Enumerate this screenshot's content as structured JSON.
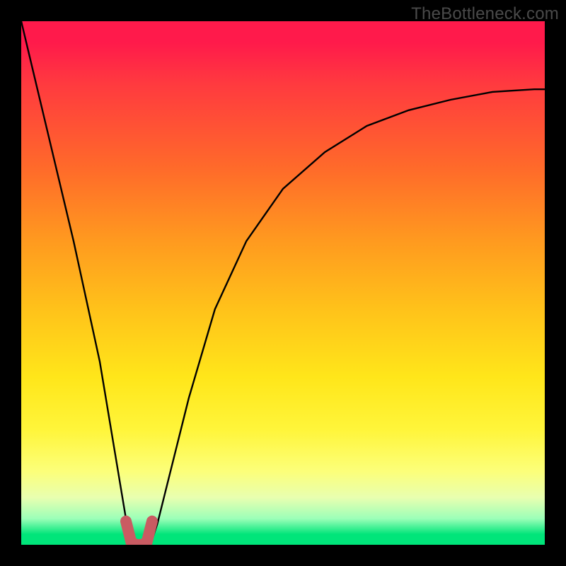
{
  "watermark": "TheBottleneck.com",
  "chart_data": {
    "type": "line",
    "title": "",
    "xlabel": "",
    "ylabel": "",
    "xlim": [
      0,
      100
    ],
    "ylim": [
      0,
      100
    ],
    "grid": false,
    "legend": false,
    "series": [
      {
        "name": "bottleneck-curve",
        "x": [
          0,
          5,
          10,
          15,
          18,
          20,
          21,
          22,
          23,
          24,
          25,
          26,
          28,
          32,
          37,
          43,
          50,
          58,
          66,
          74,
          82,
          90,
          98,
          100
        ],
        "values": [
          100,
          79,
          58,
          35,
          17,
          5,
          1,
          0,
          0,
          0,
          1,
          4,
          12,
          28,
          45,
          58,
          68,
          75,
          80,
          83,
          85,
          86.5,
          87,
          87
        ]
      },
      {
        "name": "optimal-marker",
        "x": [
          20,
          21,
          22,
          23,
          24,
          25
        ],
        "values": [
          4.5,
          0.5,
          0,
          0,
          0.5,
          4.5
        ]
      }
    ],
    "colors": {
      "curve": "#000000",
      "marker": "#c95b62",
      "background_top": "#ff1a4b",
      "background_mid": "#ffe61a",
      "background_bottom": "#00e57a"
    }
  }
}
